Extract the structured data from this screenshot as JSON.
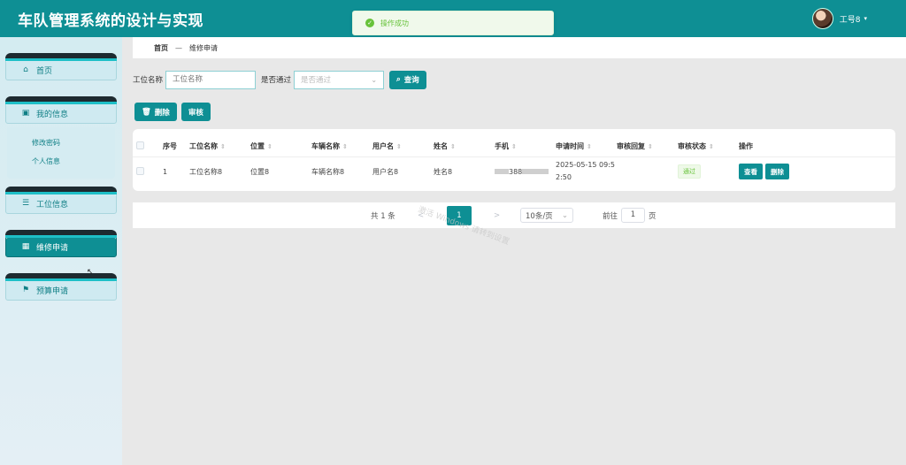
{
  "app": {
    "title": "车队管理系统的设计与实现"
  },
  "user": {
    "name": "工号8",
    "caret": "▾"
  },
  "toast": {
    "message": "操作成功",
    "icon": "✓"
  },
  "sidebar": {
    "items": [
      {
        "label": "首页",
        "icon": "⌂"
      },
      {
        "label": "我的信息",
        "icon": "▣"
      },
      {
        "label": "工位信息",
        "icon": "☰"
      },
      {
        "label": "维修申请",
        "icon": "▦"
      },
      {
        "label": "预算申请",
        "icon": "⚑"
      }
    ],
    "submenu": [
      {
        "label": "修改密码"
      },
      {
        "label": "个人信息"
      }
    ]
  },
  "breadcrumb": {
    "home": "首页",
    "sep": "—",
    "current": "维修申请"
  },
  "search": {
    "field1_label": "工位名称",
    "field1_placeholder": "工位名称",
    "field2_label": "是否通过",
    "field2_placeholder": "是否通过",
    "query_button": "查询",
    "query_icon": "⌕"
  },
  "actions": {
    "delete_label": "删除",
    "delete_icon": "🗑",
    "review_label": "审核"
  },
  "table": {
    "sort_glyph": "⇕",
    "columns": [
      "序号",
      "工位名称",
      "位置",
      "车辆名称",
      "用户名",
      "姓名",
      "手机",
      "申请时间",
      "审核回复",
      "审核状态",
      "操作"
    ],
    "rows": [
      {
        "index": "1",
        "station_name": "工位名称8",
        "location": "位置8",
        "vehicle_name": "车辆名称8",
        "username": "用户名8",
        "name": "姓名8",
        "phone_visible": "388",
        "apply_time_line1": "2025-05-15 09:5",
        "apply_time_line2": "2:50",
        "reply": "",
        "status": "通过",
        "view_label": "查看",
        "delete_label": "删除"
      }
    ]
  },
  "pagination": {
    "total": "共 1 条",
    "prev": "<",
    "current_page": "1",
    "next": ">",
    "page_size": "10条/页",
    "goto_label": "前往",
    "goto_value": "1",
    "page_suffix": "页"
  },
  "watermark": {
    "text": "激活 Windows 请转到设置"
  }
}
